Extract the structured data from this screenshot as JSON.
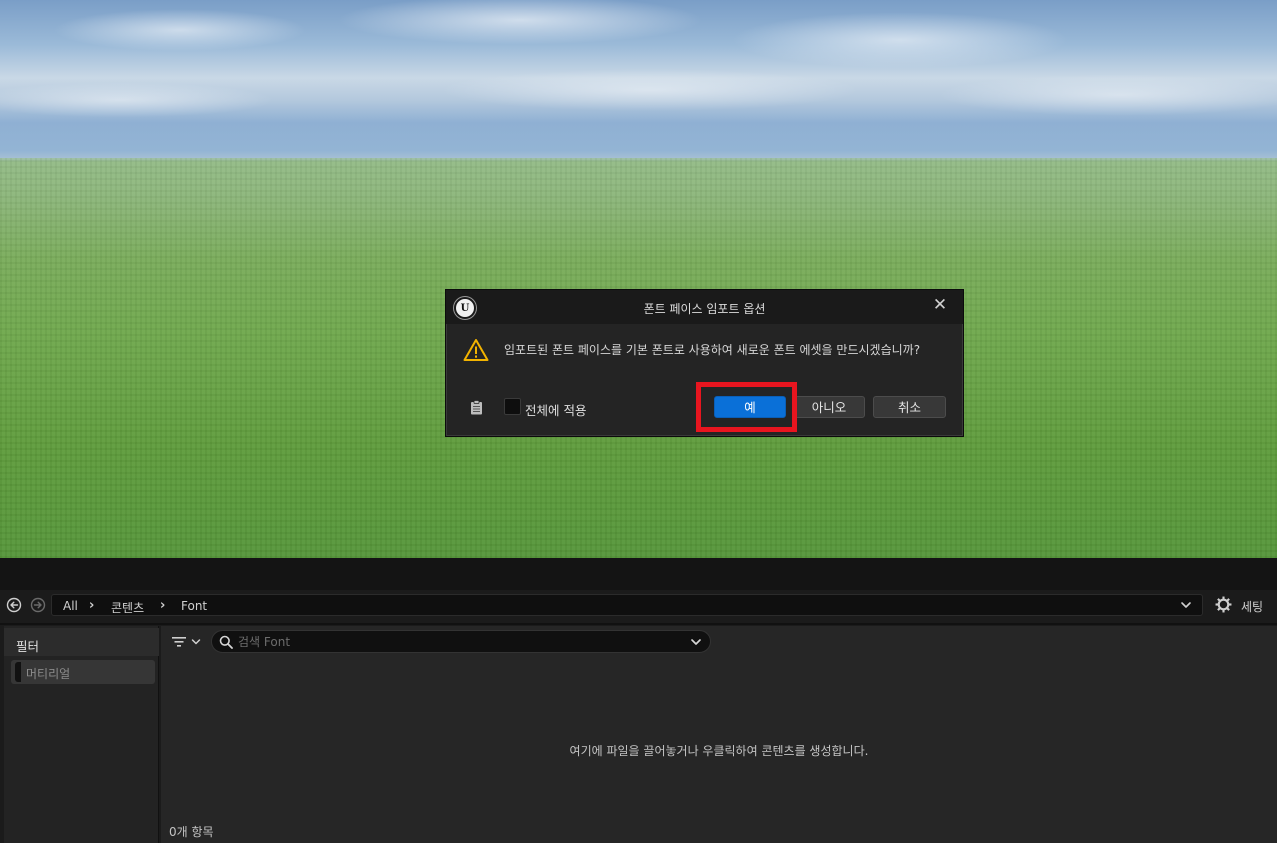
{
  "dialog": {
    "title": "폰트 페이스 임포트 옵션",
    "message": "임포트된 폰트 페이스를 기본 폰트로 사용하여 새로운 폰트 에셋을 만드시겠습니까?",
    "apply_all_label": "전체에 적용",
    "apply_all_checked": false,
    "buttons": {
      "yes": "예",
      "no": "아니오",
      "cancel": "취소"
    },
    "close_glyph": "✕",
    "highlight_color": "#e8151f"
  },
  "content_browser": {
    "breadcrumbs": [
      "All",
      "콘텐츠",
      "Font"
    ],
    "settings_label": "세팅",
    "filter_panel": {
      "title": "필터",
      "items": [
        "머티리얼"
      ]
    },
    "search": {
      "placeholder": "검색 Font",
      "value": ""
    },
    "empty_message": "여기에 파일을 끌어놓거나 우클릭하여 콘텐츠를 생성합니다.",
    "item_count": "0개 항목"
  },
  "colors": {
    "primary_button": "#0a70d8",
    "panel": "#242424",
    "background": "#1b1b1b"
  }
}
